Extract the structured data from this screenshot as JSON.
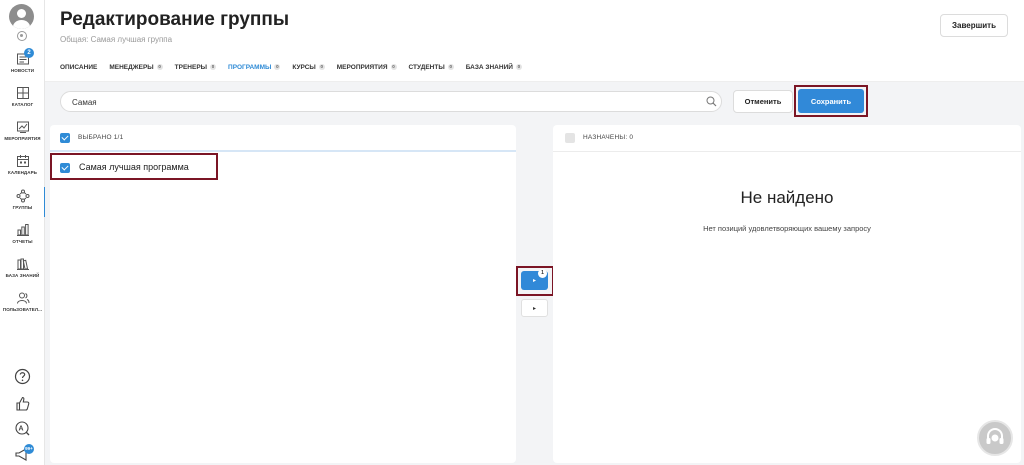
{
  "header": {
    "title": "Редактирование группы",
    "subtitle": "Общая: Самая лучшая группа",
    "finish_label": "Завершить"
  },
  "tabs": [
    {
      "label": "ОПИСАНИЕ",
      "count": ""
    },
    {
      "label": "МЕНЕДЖЕРЫ",
      "count": "0"
    },
    {
      "label": "ТРЕНЕРЫ",
      "count": "0"
    },
    {
      "label": "ПРОГРАММЫ",
      "count": "0",
      "active": true
    },
    {
      "label": "КУРСЫ",
      "count": "0"
    },
    {
      "label": "МЕРОПРИЯТИЯ",
      "count": "0"
    },
    {
      "label": "СТУДЕНТЫ",
      "count": "0"
    },
    {
      "label": "БАЗА ЗНАНИЙ",
      "count": "0"
    }
  ],
  "sidebar": {
    "items": [
      {
        "label": "НОВОСТИ",
        "icon": "news-icon",
        "badge": "2"
      },
      {
        "label": "КАТАЛОГ",
        "icon": "catalog-icon"
      },
      {
        "label": "МЕРОПРИЯТИЯ",
        "icon": "events-icon"
      },
      {
        "label": "КАЛЕНДАРЬ",
        "icon": "calendar-icon"
      },
      {
        "label": "ГРУППЫ",
        "icon": "groups-icon",
        "active": true
      },
      {
        "label": "ОТЧЕТЫ",
        "icon": "reports-icon"
      },
      {
        "label": "БАЗА ЗНАНИЙ",
        "icon": "knowledge-base-icon"
      },
      {
        "label": "ПОЛЬЗОВАТЕЛ...",
        "icon": "users-icon"
      }
    ],
    "chat_badge": "99+"
  },
  "search": {
    "value": "Самая",
    "placeholder": ""
  },
  "actions": {
    "cancel_label": "Отменить",
    "save_label": "Сохранить"
  },
  "left_panel": {
    "header": "ВЫБРАНО 1/1",
    "items": [
      {
        "label": "Самая лучшая программа",
        "checked": true
      }
    ]
  },
  "right_panel": {
    "header": "НАЗНАЧЕНЫ: 0",
    "empty_title": "Не найдено",
    "empty_text": "Нет позиций удовлетворяющих вашему запросу"
  },
  "transfer": {
    "move_right_label": "▸",
    "move_right_count": "1",
    "move_left_label": "▸"
  },
  "colors": {
    "accent": "#3189d8",
    "highlight": "#7b1525"
  }
}
